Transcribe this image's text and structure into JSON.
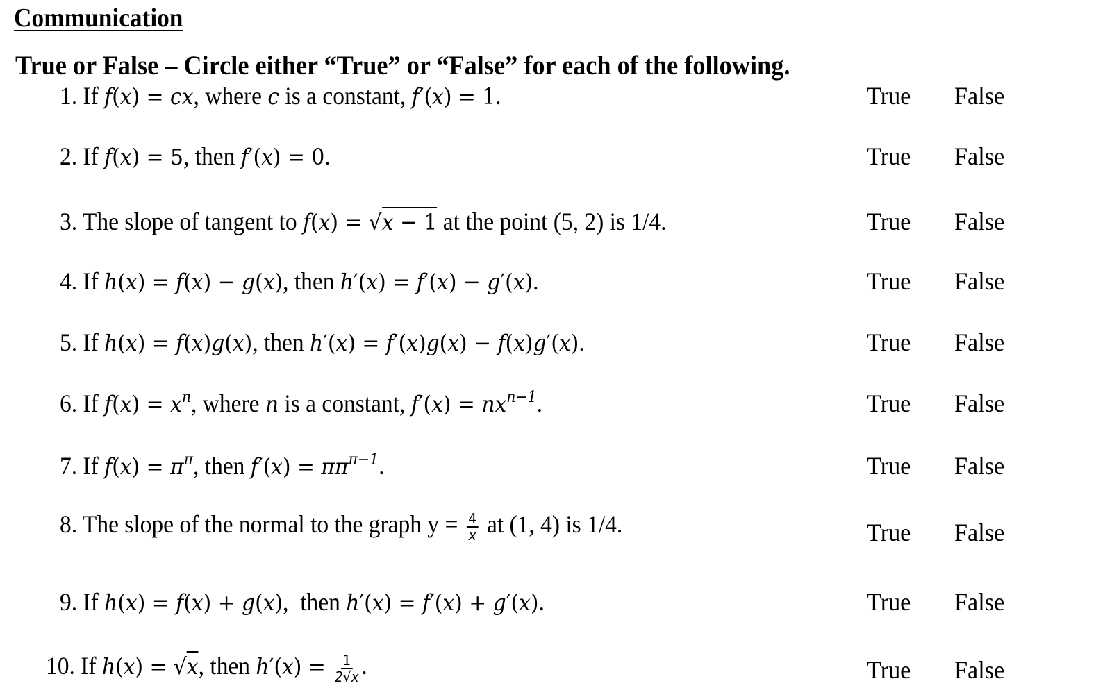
{
  "heading": "Communication",
  "instructions": "True or False – Circle either “True” or “False” for each of the following.",
  "choices": {
    "true_label": "True",
    "false_label": "False"
  },
  "questions": [
    {
      "number": "1.",
      "text": "If f(x) = cx, where c is a constant, f′(x) = 1."
    },
    {
      "number": "2.",
      "text": "If f(x) = 5, then f′(x) = 0."
    },
    {
      "number": "3.",
      "text": "The slope of tangent to f(x) = √(x − 1) at the point (5, 2) is 1/4."
    },
    {
      "number": "4.",
      "text": "If h(x) = f(x) − g(x), then h′(x) = f′(x) − g′(x)."
    },
    {
      "number": "5.",
      "text": "If h(x) = f(x)g(x), then h′(x) = f′(x)g(x) − f(x)g′(x)."
    },
    {
      "number": "6.",
      "text": "If f(x) = xⁿ, where n is a constant, f′(x) = nxⁿ⁻¹."
    },
    {
      "number": "7.",
      "text": "If f(x) = π^π, then f′(x) = ππ^(π−1)."
    },
    {
      "number": "8.",
      "text": "The slope of the normal to the graph y = 4/x at (1, 4) is 1/4."
    },
    {
      "number": "9.",
      "text": "If h(x) = f(x) + g(x), then h′(x) = f′(x) + g′(x)."
    },
    {
      "number": "10.",
      "text": "If h(x) = √x, then h′(x) = 1/(2√x)."
    }
  ],
  "parts": {
    "if": "If",
    "then": "then",
    "where": "where",
    "is_constant": "is a constant,",
    "q3_pre": "The slope of tangent to",
    "q3_post": "at the point (5, 2) is 1/4.",
    "q8_pre": "The slope of the normal to the graph y =",
    "q8_post": "at (1, 4) is 1/4.",
    "q8_num": "4",
    "q8_den": "x",
    "q10_num": "1",
    "q10_den": "2√x"
  }
}
